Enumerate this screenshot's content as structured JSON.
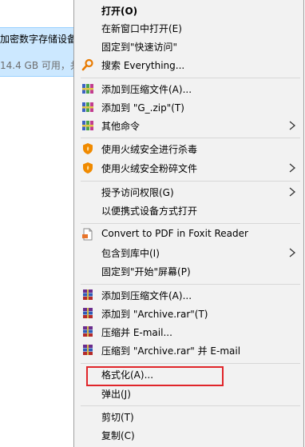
{
  "explorer": {
    "drive_name": "加密数字存储设备",
    "drive_free": "14.4 GB 可用，共"
  },
  "menu": {
    "open": "打开(O)",
    "open_new_window": "在新窗口中打开(E)",
    "pin_quick_access": "固定到\"快速访问\"",
    "search_everything": "搜索 Everything...",
    "add_to_archive_1": "添加到压缩文件(A)...",
    "add_to_g_zip": "添加到 \"G_.zip\"(T)",
    "other_commands": "其他命令",
    "scan_huorong": "使用火绒安全进行杀毒",
    "shred_huorong": "使用火绒安全粉碎文件",
    "grant_access": "授予访问权限(G)",
    "open_portable": "以便携式设备方式打开",
    "convert_pdf": "Convert to PDF in Foxit Reader",
    "include_library": "包含到库中(I)",
    "pin_start": "固定到\"开始\"屏幕(P)",
    "add_to_archive_2": "添加到压缩文件(A)...",
    "add_to_archive_rar": "添加到 \"Archive.rar\"(T)",
    "compress_email": "压缩并 E-mail...",
    "compress_rar_email": "压缩到 \"Archive.rar\" 并 E-mail",
    "format": "格式化(A)...",
    "eject": "弹出(J)",
    "cut": "剪切(T)",
    "copy": "复制(C)"
  },
  "colors": {
    "highlight_border": "#e0252a",
    "menu_bg": "#f2f2f2",
    "selection_bg": "#cce8ff"
  },
  "icons": {
    "search_everything": "magnifier-icon",
    "winrar_blue": "winrar-books-icon",
    "huorong": "huorong-shield-icon",
    "foxit": "pdf-document-icon",
    "winrar_stack": "winrar-stack-icon",
    "submenu": "chevron-right-icon"
  }
}
